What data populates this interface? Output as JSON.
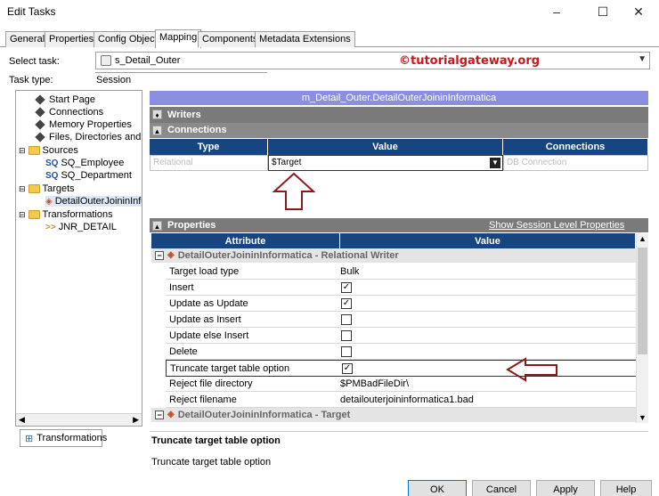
{
  "window": {
    "title": "Edit Tasks",
    "minimize": "–",
    "maximize": "☐",
    "close": "✕"
  },
  "tabs": [
    "General",
    "Properties",
    "Config Object",
    "Mapping",
    "Components",
    "Metadata Extensions"
  ],
  "active_tab": "Mapping",
  "select_task": {
    "label": "Select task:",
    "value": "s_Detail_Outer"
  },
  "task_type": {
    "label": "Task type:",
    "value": "Session"
  },
  "watermark": "©tutorialgateway.org",
  "tree": {
    "items": [
      {
        "label": "Start Page",
        "icon": "diamond-icon"
      },
      {
        "label": "Connections",
        "icon": "diamond-icon"
      },
      {
        "label": "Memory Properties",
        "icon": "diamond-icon"
      },
      {
        "label": "Files, Directories and Com",
        "icon": "diamond-icon"
      },
      {
        "label": "Sources",
        "icon": "folder-icon"
      },
      {
        "label": "SQ_Employee",
        "icon": "source-qualifier-icon"
      },
      {
        "label": "SQ_Department",
        "icon": "source-qualifier-icon"
      },
      {
        "label": "Targets",
        "icon": "folder-icon"
      },
      {
        "label": "DetailOuterJoininInfor",
        "icon": "target-icon"
      },
      {
        "label": "Transformations",
        "icon": "folder-icon"
      },
      {
        "label": "JNR_DETAIL",
        "icon": "joiner-icon"
      }
    ],
    "bottom_tab": "Transformations"
  },
  "mapping_header": "m_Detail_Outer.DetailOuterJoininInformatica",
  "writers_label": "Writers",
  "connections": {
    "label": "Connections",
    "columns": [
      "Type",
      "Value",
      "Connections"
    ],
    "row": {
      "type": "Relational",
      "value": "$Target",
      "connection": "DB Connection"
    }
  },
  "properties": {
    "label": "Properties",
    "link": "Show Session Level Properties",
    "columns": [
      "Attribute",
      "Value"
    ],
    "group1": "DetailOuterJoininInformatica - Relational Writer",
    "rows": [
      {
        "attribute": "Target load type",
        "value": "Bulk"
      },
      {
        "attribute": "Insert",
        "checked": true
      },
      {
        "attribute": "Update as Update",
        "checked": true
      },
      {
        "attribute": "Update as Insert",
        "checked": false
      },
      {
        "attribute": "Update else Insert",
        "checked": false
      },
      {
        "attribute": "Delete",
        "checked": false
      },
      {
        "attribute": "Truncate target table option",
        "checked": true
      },
      {
        "attribute": "Reject file directory",
        "value": "$PMBadFileDir\\"
      },
      {
        "attribute": "Reject filename",
        "value": "detailouterjoininformatica1.bad"
      }
    ],
    "group2": "DetailOuterJoininInformatica - Target"
  },
  "description": {
    "title": "Truncate target table option",
    "text": "Truncate target table option"
  },
  "buttons": {
    "ok": "OK",
    "cancel": "Cancel",
    "apply": "Apply",
    "help": "Help"
  },
  "colors": {
    "arrow": "#8b1a1a",
    "grid_header": "#17457f",
    "mapping_header": "#8b8fe0"
  }
}
